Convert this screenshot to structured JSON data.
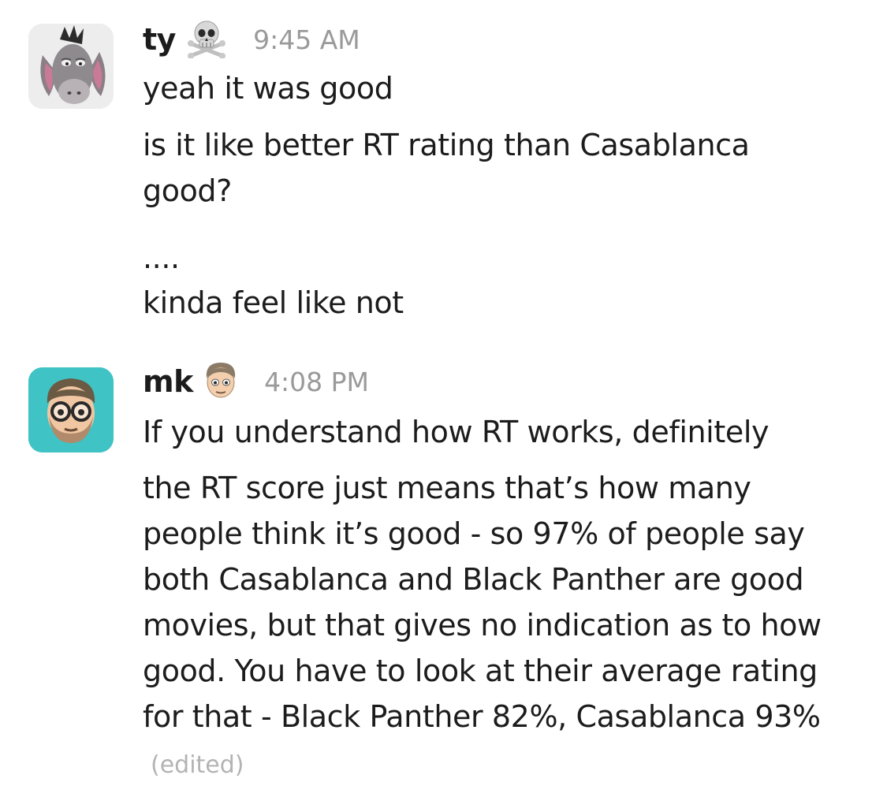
{
  "messages": [
    {
      "username": "ty",
      "status_emoji": "skull-and-crossbones-icon",
      "timestamp": "9:45 AM",
      "avatar": "donkey-avatar",
      "lines": [
        "yeah it was good",
        "is it like better RT rating than Casablanca good?",
        "....",
        "kinda feel like not"
      ]
    },
    {
      "username": "mk",
      "status_emoji": "man-face-icon",
      "timestamp": "4:08 PM",
      "avatar": "bearded-man-glasses-avatar",
      "avatar_bg": "#3fc3c4",
      "lines": [
        "If you understand how RT works, definitely",
        "the RT score just means that’s how many people think it’s good - so 97% of people say both Casablanca and Black Panther are good movies, but that gives no indication as to how good. You have to look at their average rating for that - Black Panther 82%, Casablanca 93%"
      ],
      "edited_label": "(edited)"
    }
  ]
}
